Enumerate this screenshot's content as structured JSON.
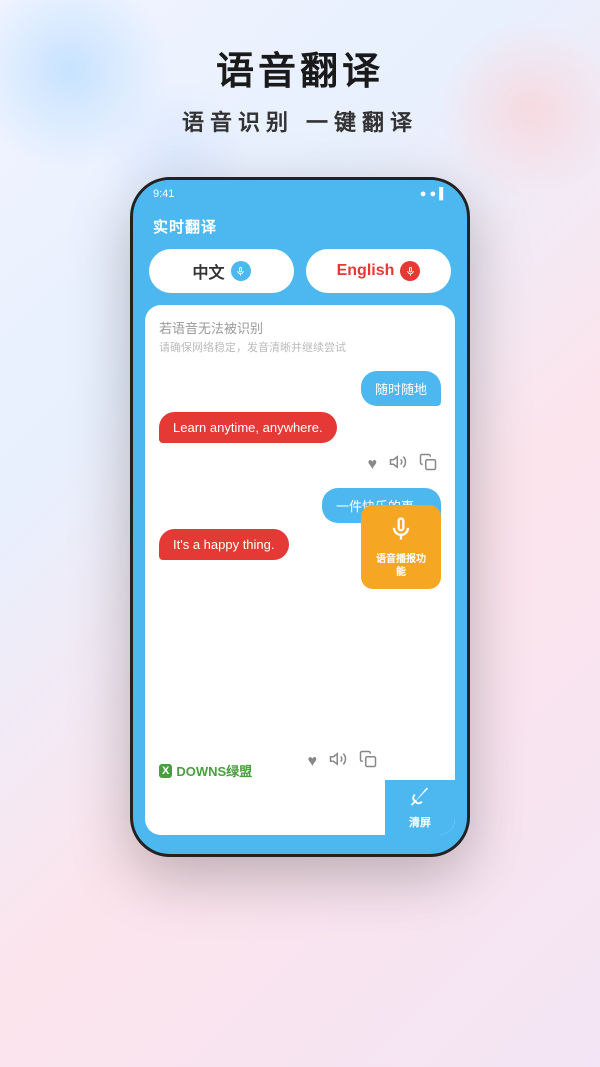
{
  "header": {
    "main_title": "语音翻译",
    "sub_title": "语音识别 一键翻译"
  },
  "app": {
    "title": "实时翻译",
    "lang_chinese": "中文",
    "lang_english": "English",
    "error_line1": "若语音无法被识别",
    "error_line2": "请确保网络稳定，发音清晰并继续尝试",
    "msg1_right": "随时随地",
    "msg1_left": "Learn anytime, anywhere.",
    "msg2_right": "一件快乐的事。",
    "msg2_left": "It's a happy thing.",
    "tooltip_text": "语音播报功能",
    "watermark": "DOWNS绿盟",
    "clear_label": "清屏"
  },
  "icons": {
    "mic": "🎤",
    "heart": "♥",
    "speaker": "🔊",
    "copy": "⊞",
    "broom": "🧹"
  }
}
